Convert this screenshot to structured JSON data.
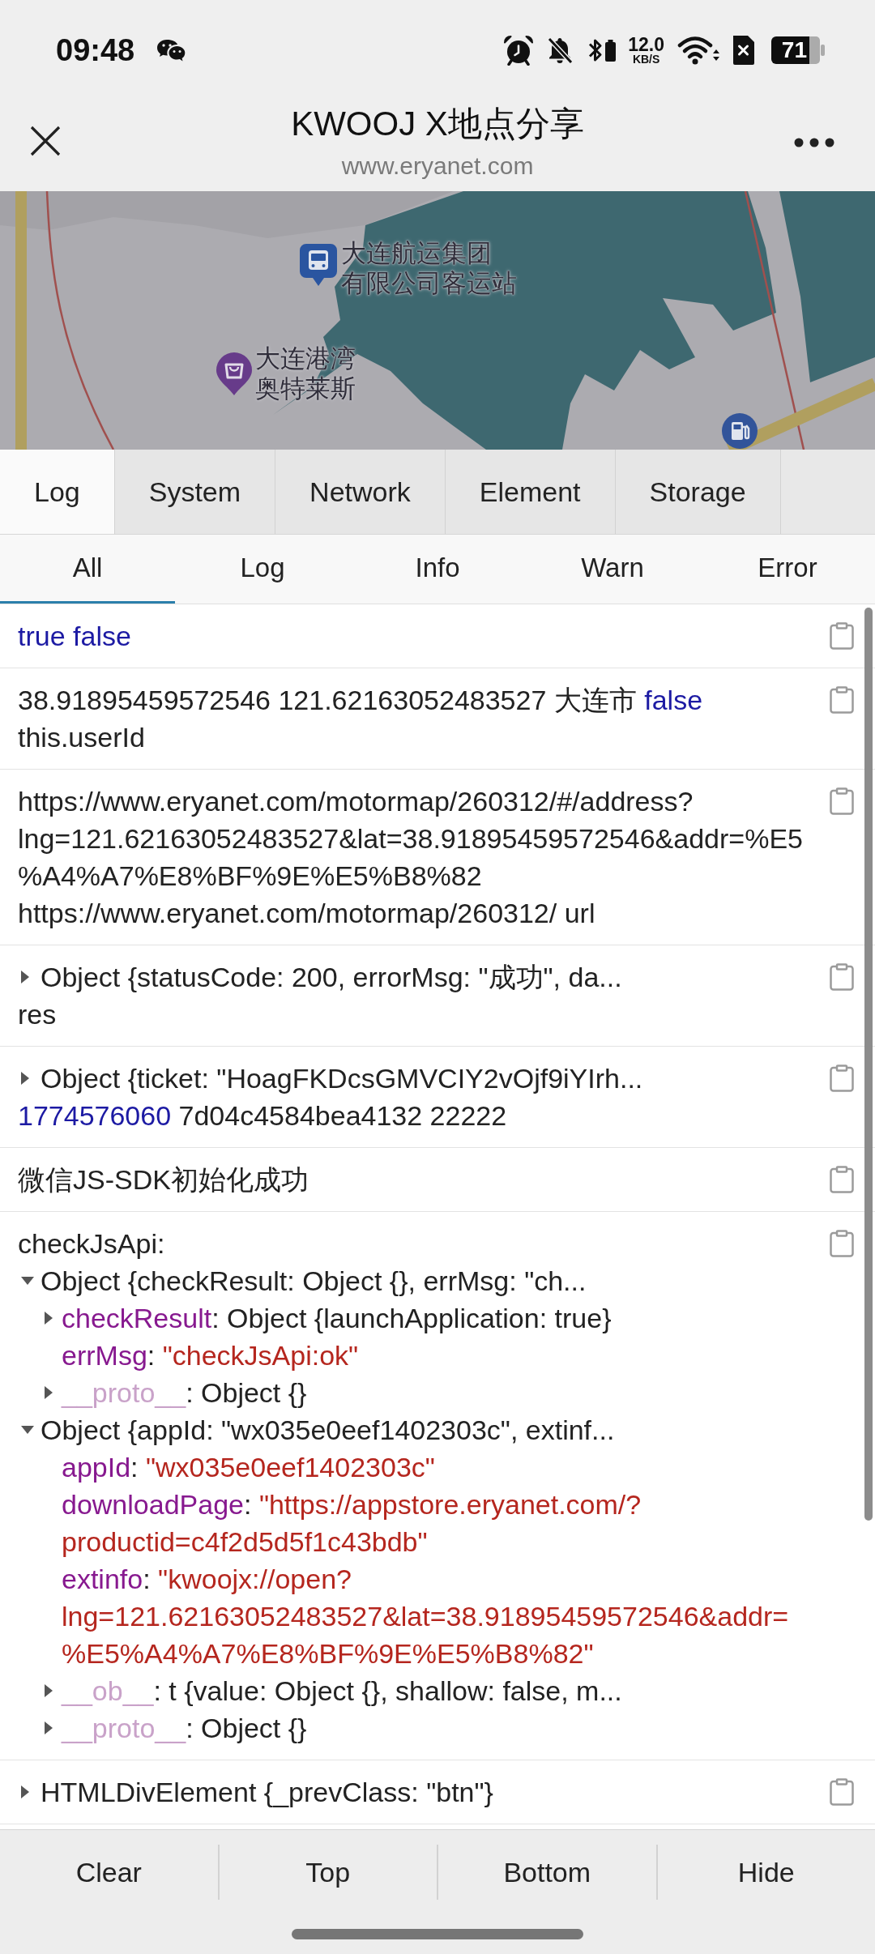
{
  "status_bar": {
    "time": "09:48",
    "net_speed": "12.0",
    "net_unit": "KB/S",
    "battery": "71"
  },
  "header": {
    "title": "KWOOJ X地点分享",
    "url": "www.eryanet.com"
  },
  "map": {
    "pois": [
      {
        "kind": "bus",
        "lines": [
          "大连航运集团",
          "有限公司客运站"
        ]
      },
      {
        "kind": "shopping",
        "lines": [
          "大连港湾",
          "奥特莱斯"
        ]
      },
      {
        "kind": "gas"
      }
    ]
  },
  "tabs": [
    {
      "label": "Log",
      "selected": true
    },
    {
      "label": "System",
      "selected": false
    },
    {
      "label": "Network",
      "selected": false
    },
    {
      "label": "Element",
      "selected": false
    },
    {
      "label": "Storage",
      "selected": false
    }
  ],
  "filters": [
    {
      "label": "All",
      "selected": true
    },
    {
      "label": "Log",
      "selected": false
    },
    {
      "label": "Info",
      "selected": false
    },
    {
      "label": "Warn",
      "selected": false
    },
    {
      "label": "Error",
      "selected": false
    }
  ],
  "logs": [
    {
      "items": [
        {
          "kind": "text",
          "parts": [
            {
              "kind": "keyword",
              "text": "true false"
            }
          ]
        }
      ]
    },
    {
      "items": [
        {
          "kind": "text",
          "parts": [
            {
              "kind": "plain",
              "text": "38.91895459572546 121.62163052483527 大连市 "
            },
            {
              "kind": "keyword",
              "text": "false"
            },
            {
              "kind": "plain",
              "text": " this.userId"
            }
          ]
        }
      ]
    },
    {
      "items": [
        {
          "kind": "text",
          "parts": [
            {
              "kind": "plain",
              "text": "https://www.eryanet.com/motormap/260312/#/address?lng=121.62163052483527&lat=38.91895459572546&addr=%E5%A4%A7%E8%BF%9E%E5%B8%82 https://www.eryanet.com/motormap/260312/ url"
            }
          ]
        }
      ]
    },
    {
      "items": [
        {
          "kind": "object",
          "expanded": false,
          "summary": "Object {statusCode: 200, errorMsg: \"成功\", da..."
        },
        {
          "kind": "text",
          "parts": [
            {
              "kind": "plain",
              "text": "res"
            }
          ]
        }
      ]
    },
    {
      "items": [
        {
          "kind": "object",
          "expanded": false,
          "summary": "Object {ticket: \"HoagFKDcsGMVCIY2vOjf9iYIrh..."
        },
        {
          "kind": "text",
          "parts": [
            {
              "kind": "number",
              "text": "1774576060"
            },
            {
              "kind": "plain",
              "text": " 7d04c4584bea4132 22222"
            }
          ]
        }
      ]
    },
    {
      "items": [
        {
          "kind": "text",
          "parts": [
            {
              "kind": "plain",
              "text": "微信JS-SDK初始化成功"
            }
          ]
        }
      ]
    },
    {
      "items": [
        {
          "kind": "text",
          "parts": [
            {
              "kind": "plain",
              "text": "checkJsApi:"
            }
          ]
        },
        {
          "kind": "object",
          "expanded": true,
          "summary": "Object {checkResult: Object {}, errMsg: \"ch...",
          "children": [
            {
              "kind": "branch",
              "expanded": false,
              "parts": [
                {
                  "kind": "key",
                  "text": "checkResult"
                },
                {
                  "kind": "plain",
                  "text": ": Object {launchApplication: true}"
                }
              ]
            },
            {
              "kind": "leaf",
              "parts": [
                {
                  "kind": "key",
                  "text": "errMsg"
                },
                {
                  "kind": "plain",
                  "text": ": "
                },
                {
                  "kind": "string",
                  "text": "\"checkJsApi:ok\""
                }
              ]
            },
            {
              "kind": "branch",
              "expanded": false,
              "parts": [
                {
                  "kind": "internal_key",
                  "text": "__proto__"
                },
                {
                  "kind": "plain",
                  "text": ": Object {}"
                }
              ]
            }
          ]
        },
        {
          "kind": "object",
          "expanded": true,
          "summary": "Object {appId: \"wx035e0eef1402303c\", extinf...",
          "children": [
            {
              "kind": "leaf",
              "parts": [
                {
                  "kind": "key",
                  "text": "appId"
                },
                {
                  "kind": "plain",
                  "text": ": "
                },
                {
                  "kind": "string",
                  "text": "\"wx035e0eef1402303c\""
                }
              ]
            },
            {
              "kind": "leaf",
              "parts": [
                {
                  "kind": "key",
                  "text": "downloadPage"
                },
                {
                  "kind": "plain",
                  "text": ": "
                },
                {
                  "kind": "string",
                  "text": "\"https://appstore.eryanet.com/?productid=c4f2d5d5f1c43bdb\""
                }
              ]
            },
            {
              "kind": "leaf",
              "parts": [
                {
                  "kind": "key",
                  "text": "extinfo"
                },
                {
                  "kind": "plain",
                  "text": ": "
                },
                {
                  "kind": "string",
                  "text": "\"kwoojx://open?lng=121.62163052483527&lat=38.91895459572546&addr=%E5%A4%A7%E8%BF%9E%E5%B8%82\""
                }
              ]
            },
            {
              "kind": "branch",
              "expanded": false,
              "parts": [
                {
                  "kind": "internal_key",
                  "text": "__ob__"
                },
                {
                  "kind": "plain",
                  "text": ": t {value: Object {}, shallow: false, m..."
                }
              ]
            },
            {
              "kind": "branch",
              "expanded": false,
              "parts": [
                {
                  "kind": "internal_key",
                  "text": "__proto__"
                },
                {
                  "kind": "plain",
                  "text": ": Object {}"
                }
              ]
            }
          ]
        }
      ]
    },
    {
      "items": [
        {
          "kind": "object",
          "expanded": false,
          "summary": "HTMLDivElement {_prevClass: \"btn\"}"
        }
      ]
    }
  ],
  "toolbar": [
    "Clear",
    "Top",
    "Bottom",
    "Hide"
  ]
}
